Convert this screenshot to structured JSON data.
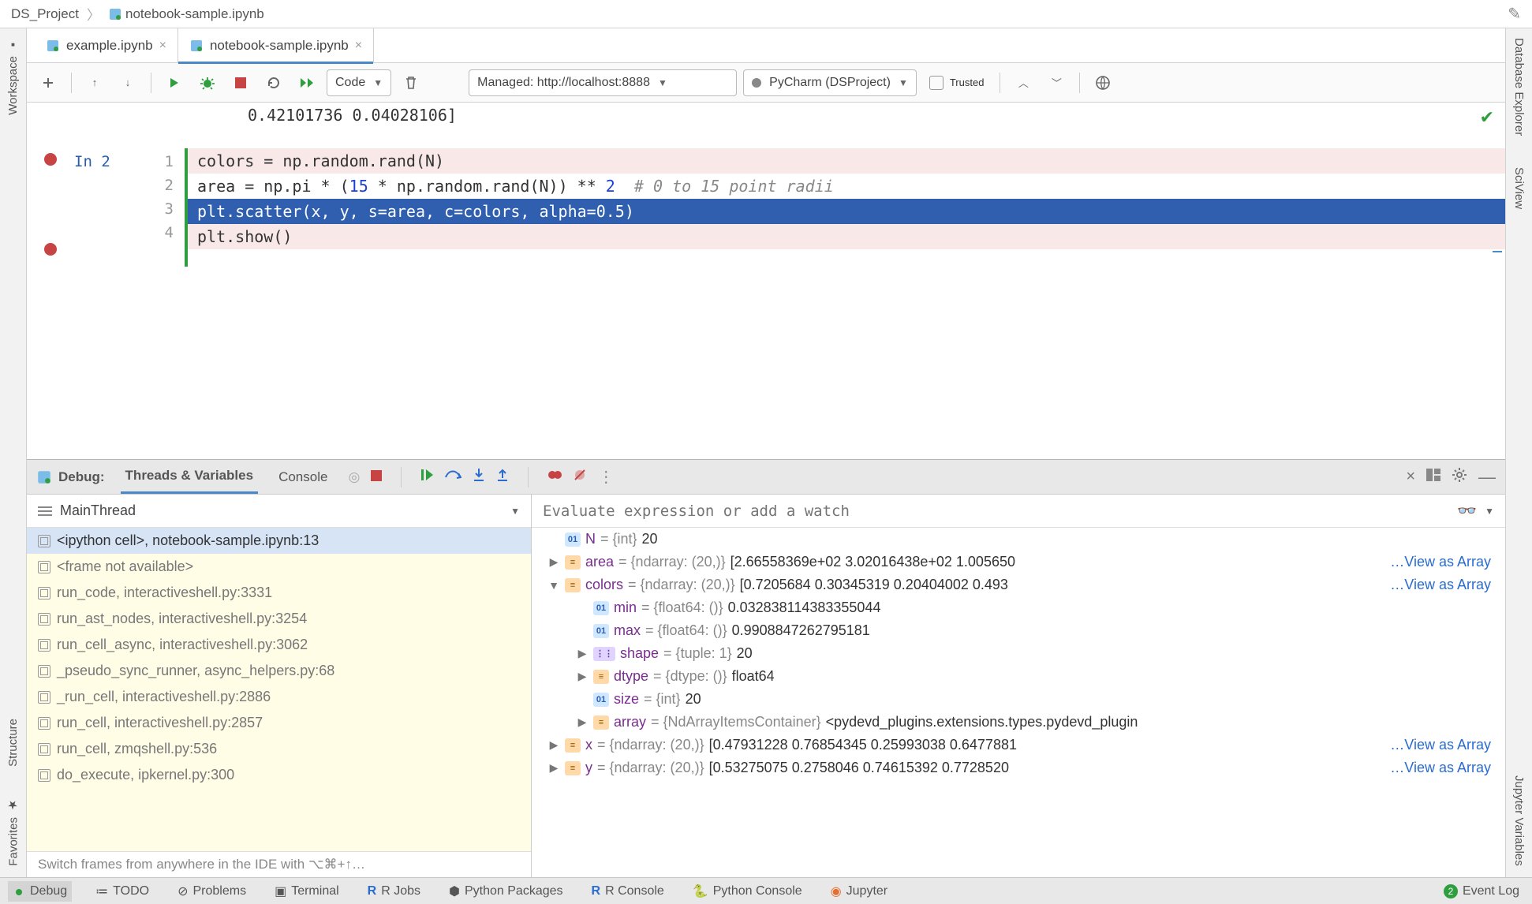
{
  "breadcrumb": {
    "project": "DS_Project",
    "file": "notebook-sample.ipynb"
  },
  "tabs": [
    {
      "label": "example.ipynb",
      "active": false
    },
    {
      "label": "notebook-sample.ipynb",
      "active": true
    }
  ],
  "sidebars": {
    "left": [
      "Workspace",
      "Structure",
      "Favorites"
    ],
    "right": [
      "Database Explorer",
      "SciView",
      "Jupyter Variables"
    ]
  },
  "toolbar": {
    "cell_type": "Code",
    "server": "Managed: http://localhost:8888",
    "kernel": "PyCharm (DSProject)",
    "trusted": "Trusted"
  },
  "editor": {
    "prev_output": "0.42101736 0.04028106]",
    "in_label": "In 2",
    "lines": [
      {
        "n": 1,
        "bp": true,
        "sel": false,
        "html": "colors = np.random.rand(N)"
      },
      {
        "n": 2,
        "bp": false,
        "sel": false,
        "html": "area = np.pi * (<span class='num'>15</span> * np.random.rand(N)) ** <span class='num'>2</span>  <span class='cmt'># 0 to 15 point radii</span>"
      },
      {
        "n": 3,
        "bp": false,
        "sel": true,
        "html": "plt.scatter(x, y, s=area, c=colors, alpha=0.5)"
      },
      {
        "n": 4,
        "bp": true,
        "sel": false,
        "html": "plt.show()"
      }
    ]
  },
  "debug": {
    "title": "Debug:",
    "tabs": {
      "threads": "Threads & Variables",
      "console": "Console"
    },
    "thread": "MainThread",
    "eval_placeholder": "Evaluate expression or add a watch",
    "frames": [
      {
        "label": "<ipython cell>, notebook-sample.ipynb:13",
        "sel": true
      },
      {
        "label": "<frame not available>",
        "sel": false
      },
      {
        "label": "run_code, interactiveshell.py:3331",
        "sel": false
      },
      {
        "label": "run_ast_nodes, interactiveshell.py:3254",
        "sel": false
      },
      {
        "label": "run_cell_async, interactiveshell.py:3062",
        "sel": false
      },
      {
        "label": "_pseudo_sync_runner, async_helpers.py:68",
        "sel": false
      },
      {
        "label": "_run_cell, interactiveshell.py:2886",
        "sel": false
      },
      {
        "label": "run_cell, interactiveshell.py:2857",
        "sel": false
      },
      {
        "label": "run_cell, zmqshell.py:536",
        "sel": false
      },
      {
        "label": "do_execute, ipkernel.py:300",
        "sel": false
      }
    ],
    "switch_hint": "Switch frames from anywhere in the IDE with ⌥⌘+↑…",
    "vars": [
      {
        "indent": 0,
        "twist": "",
        "badge": "int",
        "name": "N",
        "meta": " = {int} ",
        "val": "20",
        "view": false
      },
      {
        "indent": 0,
        "twist": "▶",
        "badge": "arr",
        "name": "area",
        "meta": " = {ndarray: (20,)} ",
        "val": "[2.66558369e+02 3.02016438e+02 1.005650",
        "view": true
      },
      {
        "indent": 0,
        "twist": "▼",
        "badge": "arr",
        "name": "colors",
        "meta": " = {ndarray: (20,)} ",
        "val": "[0.7205684  0.30345319 0.20404002 0.493",
        "view": true
      },
      {
        "indent": 1,
        "twist": "",
        "badge": "int",
        "name": "min",
        "meta": " = {float64: ()} ",
        "val": "0.032838114383355044",
        "view": false
      },
      {
        "indent": 1,
        "twist": "",
        "badge": "int",
        "name": "max",
        "meta": " = {float64: ()} ",
        "val": "0.9908847262795181",
        "view": false
      },
      {
        "indent": 1,
        "twist": "▶",
        "badge": "list",
        "name": "shape",
        "meta": " = {tuple: 1} ",
        "val": "20",
        "view": false
      },
      {
        "indent": 1,
        "twist": "▶",
        "badge": "arr",
        "name": "dtype",
        "meta": " = {dtype: ()} ",
        "val": "float64",
        "view": false
      },
      {
        "indent": 1,
        "twist": "",
        "badge": "int",
        "name": "size",
        "meta": " = {int} ",
        "val": "20",
        "view": false
      },
      {
        "indent": 1,
        "twist": "▶",
        "badge": "arr",
        "name": "array",
        "meta": " = {NdArrayItemsContainer} ",
        "val": "<pydevd_plugins.extensions.types.pydevd_plugin",
        "view": false
      },
      {
        "indent": 0,
        "twist": "▶",
        "badge": "arr",
        "name": "x",
        "meta": " = {ndarray: (20,)} ",
        "val": "[0.47931228 0.76854345 0.25993038 0.6477881",
        "view": true
      },
      {
        "indent": 0,
        "twist": "▶",
        "badge": "arr",
        "name": "y",
        "meta": " = {ndarray: (20,)} ",
        "val": "[0.53275075 0.2758046  0.74615392 0.7728520",
        "view": true
      }
    ],
    "view_as_array": "…View as Array"
  },
  "bottom": {
    "items": [
      "Debug",
      "TODO",
      "Problems",
      "Terminal",
      "R Jobs",
      "Python Packages",
      "R Console",
      "Python Console",
      "Jupyter",
      "Event Log"
    ],
    "event_badge": "2"
  }
}
